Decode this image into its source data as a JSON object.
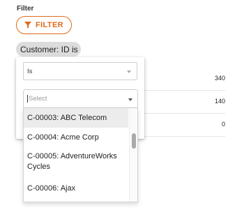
{
  "filter": {
    "heading": "Filter",
    "button_label": "FILTER",
    "button_icon": "funnel-icon",
    "accent_color": "#e06a1b"
  },
  "chip": {
    "label": "Customer: ID is"
  },
  "background_values": [
    "340",
    "140",
    "0"
  ],
  "popover": {
    "operator": {
      "value": "Is"
    },
    "value_select": {
      "placeholder": "Select"
    },
    "options": [
      "C-00003: ABC Telecom",
      "C-00004: Acme Corp",
      "C-00005: AdventureWorks Cycles",
      "C-00006: Ajax"
    ]
  }
}
